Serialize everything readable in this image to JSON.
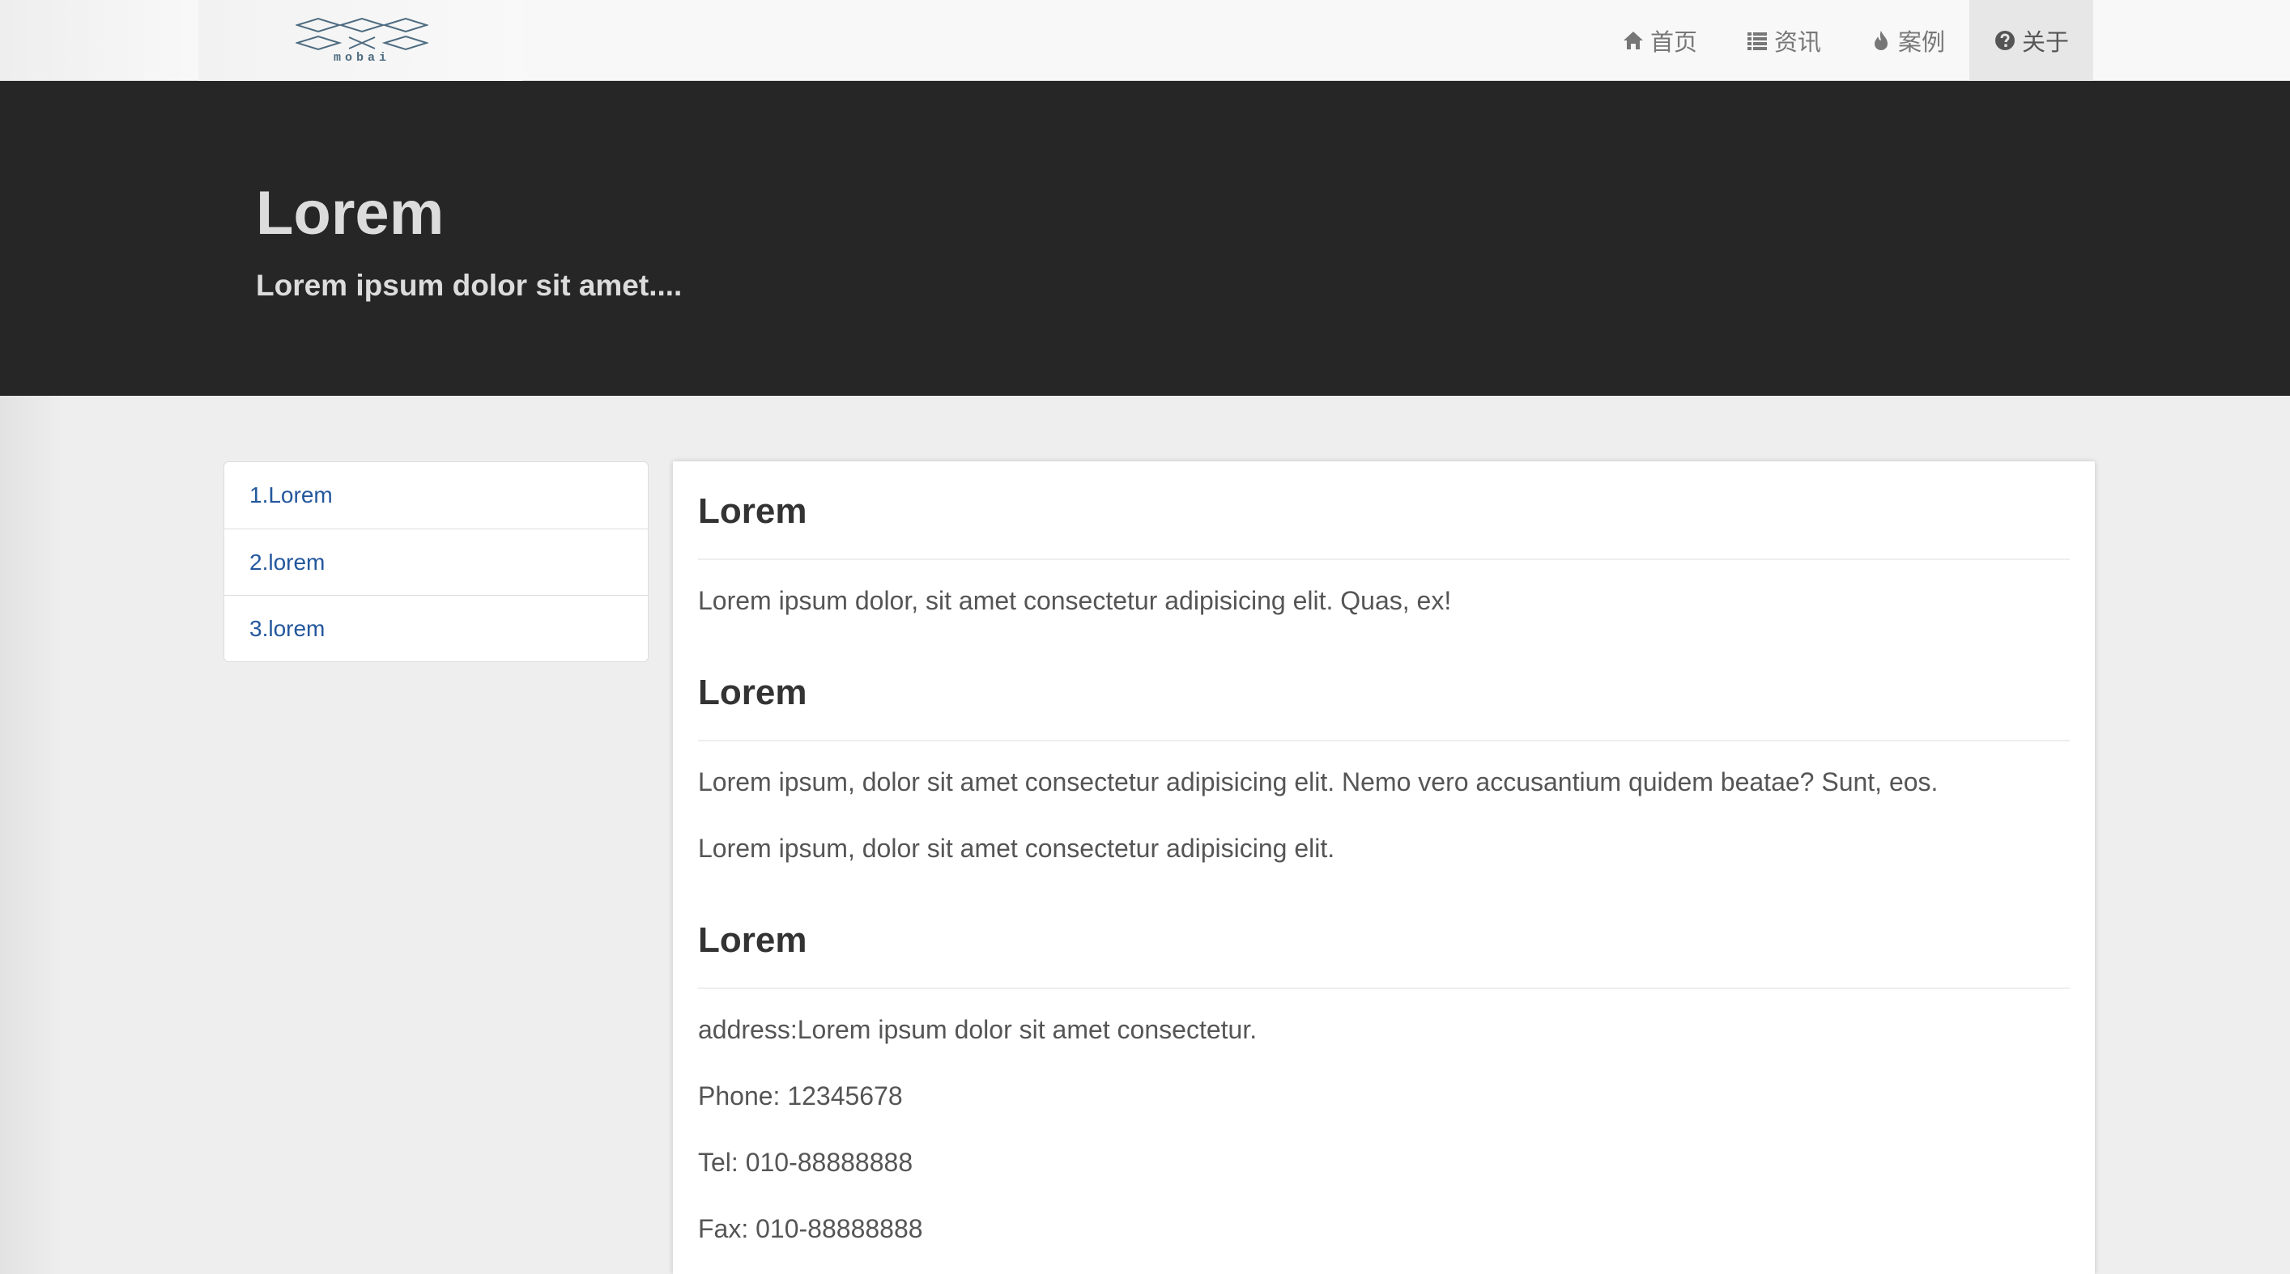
{
  "navbar": {
    "logo_text": "mobai",
    "items": [
      {
        "label": "首页",
        "icon": "home-icon"
      },
      {
        "label": "资讯",
        "icon": "list-icon"
      },
      {
        "label": "案例",
        "icon": "fire-icon"
      },
      {
        "label": "关于",
        "icon": "question-circle-icon",
        "active": true
      }
    ]
  },
  "hero": {
    "title": "Lorem",
    "subtitle": "Lorem ipsum dolor sit amet...."
  },
  "sidebar": {
    "items": [
      {
        "label": "1.Lorem"
      },
      {
        "label": "2.lorem"
      },
      {
        "label": "3.lorem"
      }
    ]
  },
  "content": {
    "sections": [
      {
        "title": "Lorem",
        "paragraphs": [
          "Lorem ipsum dolor, sit amet consectetur adipisicing elit. Quas, ex!"
        ]
      },
      {
        "title": "Lorem",
        "paragraphs": [
          "Lorem ipsum, dolor sit amet consectetur adipisicing elit. Nemo vero accusantium quidem beatae? Sunt, eos.",
          "Lorem ipsum, dolor sit amet consectetur adipisicing elit."
        ]
      },
      {
        "title": "Lorem",
        "paragraphs": [
          "address:Lorem ipsum dolor sit amet consectetur.",
          "Phone: 12345678",
          "Tel: 010-88888888",
          "Fax: 010-88888888"
        ]
      }
    ]
  },
  "colors": {
    "navbar_bg": "#f8f8f8",
    "hero_bg": "#262626",
    "link": "#23579d",
    "page_bg": "#eeeeee"
  }
}
